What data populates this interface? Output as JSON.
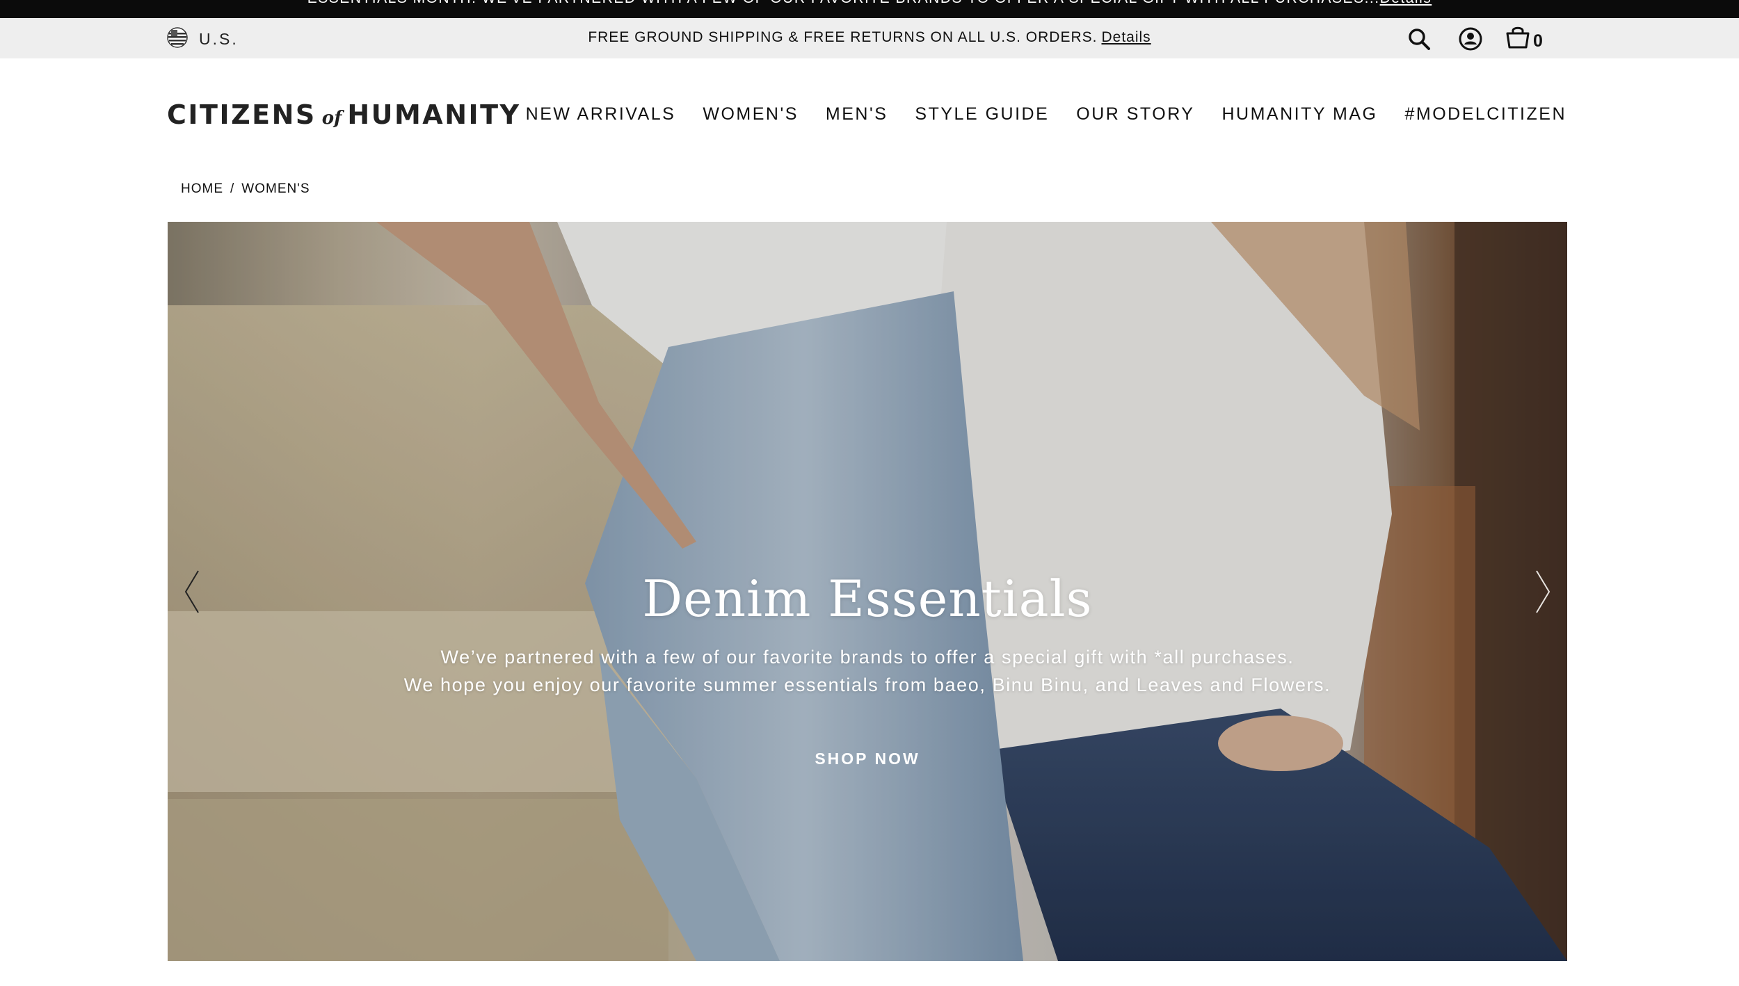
{
  "promo": {
    "text": "ESSENTIALS MONTH: WE'VE PARTNERED WITH A FEW OF OUR FAVORITE BRANDS TO OFFER A SPECIAL GIFT WITH ALL PURCHASES...",
    "link": "Details"
  },
  "utility": {
    "locale": "U.S.",
    "shipping_text": "FREE GROUND SHIPPING & FREE RETURNS ON ALL U.S. ORDERS.",
    "shipping_link": "Details",
    "cart_count": "0"
  },
  "header": {
    "logo": {
      "left": "CITIZENS",
      "middle": "of",
      "right": "HUMANITY"
    },
    "nav": [
      "NEW ARRIVALS",
      "WOMEN'S",
      "MEN'S",
      "STYLE GUIDE",
      "OUR STORY",
      "HUMANITY MAG",
      "#MODELCITIZEN"
    ]
  },
  "breadcrumb": {
    "home": "HOME",
    "separator": "/",
    "current": "WOMEN'S"
  },
  "hero": {
    "title": "Denim Essentials",
    "line1": "We’ve partnered with a few of our favorite brands to offer a special gift with *all purchases.",
    "line2": "We hope you enjoy our favorite summer essentials from baeo, Binu Binu, and Leaves and Flowers.",
    "cta": "SHOP NOW"
  },
  "icons": {
    "locale": "us-flag-icon",
    "search": "search-icon",
    "account": "account-icon",
    "cart": "shopping-bag-icon",
    "prev": "chevron-left-icon",
    "next": "chevron-right-icon"
  },
  "colors": {
    "promo_bg": "#0b0b0b",
    "utility_bg": "#eeeeee",
    "text": "#111111",
    "hero_text": "#ffffff"
  }
}
